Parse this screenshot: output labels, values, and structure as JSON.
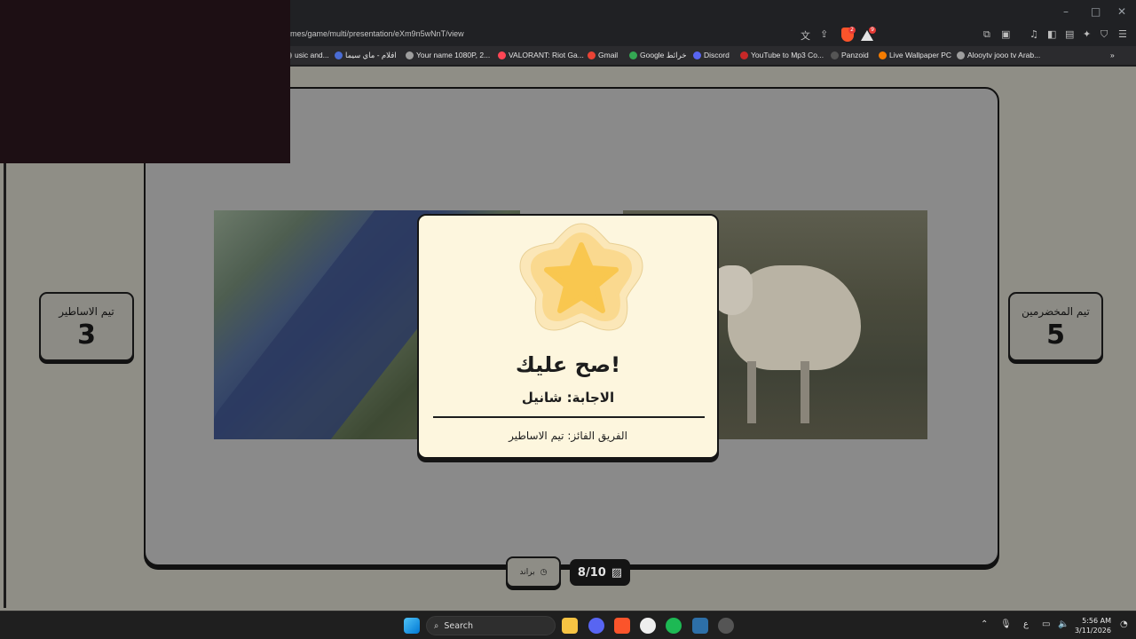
{
  "browser": {
    "url": "mes/game/multi/presentation/eXm9n5wNnT/view",
    "window_controls": {
      "minimize": "–",
      "maximize": "□",
      "close": "✕"
    },
    "shield_badge": "2",
    "alert_badge": "9",
    "bookmarks": [
      {
        "label": "usic and...",
        "icon": "music-icon",
        "color": "#888888"
      },
      {
        "label": "افلام - ماي سيما",
        "icon": "mycima-icon",
        "color": "#4a6cd4"
      },
      {
        "label": "Your name 1080P, 2...",
        "icon": "globe-icon",
        "color": "#9e9e9e"
      },
      {
        "label": "VALORANT: Riot Ga...",
        "icon": "valorant-icon",
        "color": "#ff4655"
      },
      {
        "label": "Gmail",
        "icon": "gmail-icon",
        "color": "#ea4335"
      },
      {
        "label": "Google خرائط",
        "icon": "maps-icon",
        "color": "#34a853"
      },
      {
        "label": "Discord",
        "icon": "discord-icon",
        "color": "#5865f2"
      },
      {
        "label": "YouTube to Mp3 Co...",
        "icon": "youtube-icon",
        "color": "#c62828"
      },
      {
        "label": "Panzoid",
        "icon": "panzoid-icon",
        "color": "#555555"
      },
      {
        "label": "Live Wallpaper PC",
        "icon": "wallpaper-icon",
        "color": "#f57c00"
      },
      {
        "label": "Alooytv jooo tv Arab...",
        "icon": "globe-icon",
        "color": "#9e9e9e"
      }
    ],
    "bookmarks_more": "»"
  },
  "game": {
    "team_left": {
      "name": "تيم الاساطير",
      "score": "3"
    },
    "team_right": {
      "name": "تيم المخضرمين",
      "score": "5"
    },
    "result": {
      "title": "صح عليك!",
      "answer": "الاجابة: شانيل",
      "winner": "الفريق الفائز: تيم الاساطير"
    },
    "hint_button": "براند",
    "progress": "8/10"
  },
  "taskbar": {
    "search_placeholder": "Search",
    "lang": "ع",
    "time": "5:56 AM",
    "date": "3/11/2026",
    "discord_badge": "9"
  },
  "colors": {
    "modal_bg": "#fdf6de",
    "star_fill": "#f9c74f",
    "page_dim": "#8f8e86"
  }
}
